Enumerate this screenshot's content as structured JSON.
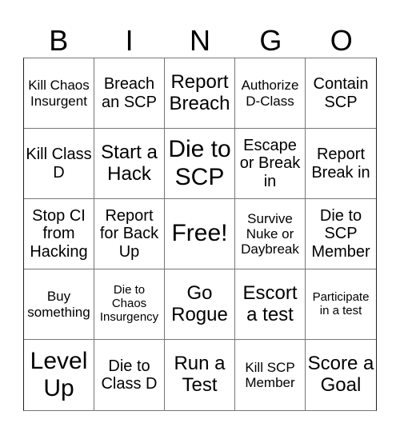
{
  "header": {
    "letters": [
      "B",
      "I",
      "N",
      "G",
      "O"
    ]
  },
  "cells": [
    {
      "text": "Kill Chaos Insurgent",
      "size": "s-s"
    },
    {
      "text": "Breach an SCP",
      "size": "s-m"
    },
    {
      "text": "Report Breach",
      "size": "s-l"
    },
    {
      "text": "Authorize D-Class",
      "size": "s-s"
    },
    {
      "text": "Contain SCP",
      "size": "s-m"
    },
    {
      "text": "Kill Class D",
      "size": "s-m"
    },
    {
      "text": "Start a Hack",
      "size": "s-l"
    },
    {
      "text": "Die to SCP",
      "size": "s-xl"
    },
    {
      "text": "Escape or Break in",
      "size": "s-m"
    },
    {
      "text": "Report Break in",
      "size": "s-m"
    },
    {
      "text": "Stop CI from Hacking",
      "size": "s-m"
    },
    {
      "text": "Report for Back Up",
      "size": "s-m"
    },
    {
      "text": "Free!",
      "size": "s-xl"
    },
    {
      "text": "Survive Nuke or Daybreak",
      "size": "s-s"
    },
    {
      "text": "Die to SCP Member",
      "size": "s-m"
    },
    {
      "text": "Buy something",
      "size": "s-s"
    },
    {
      "text": "Die to Chaos Insurgency",
      "size": "s-xs"
    },
    {
      "text": "Go Rogue",
      "size": "s-l"
    },
    {
      "text": "Escort a test",
      "size": "s-l"
    },
    {
      "text": "Participate in a test",
      "size": "s-xs"
    },
    {
      "text": "Level Up",
      "size": "s-xl"
    },
    {
      "text": "Die to Class D",
      "size": "s-m"
    },
    {
      "text": "Run a Test",
      "size": "s-l"
    },
    {
      "text": "Kill SCP Member",
      "size": "s-s"
    },
    {
      "text": "Score a Goal",
      "size": "s-l"
    }
  ]
}
